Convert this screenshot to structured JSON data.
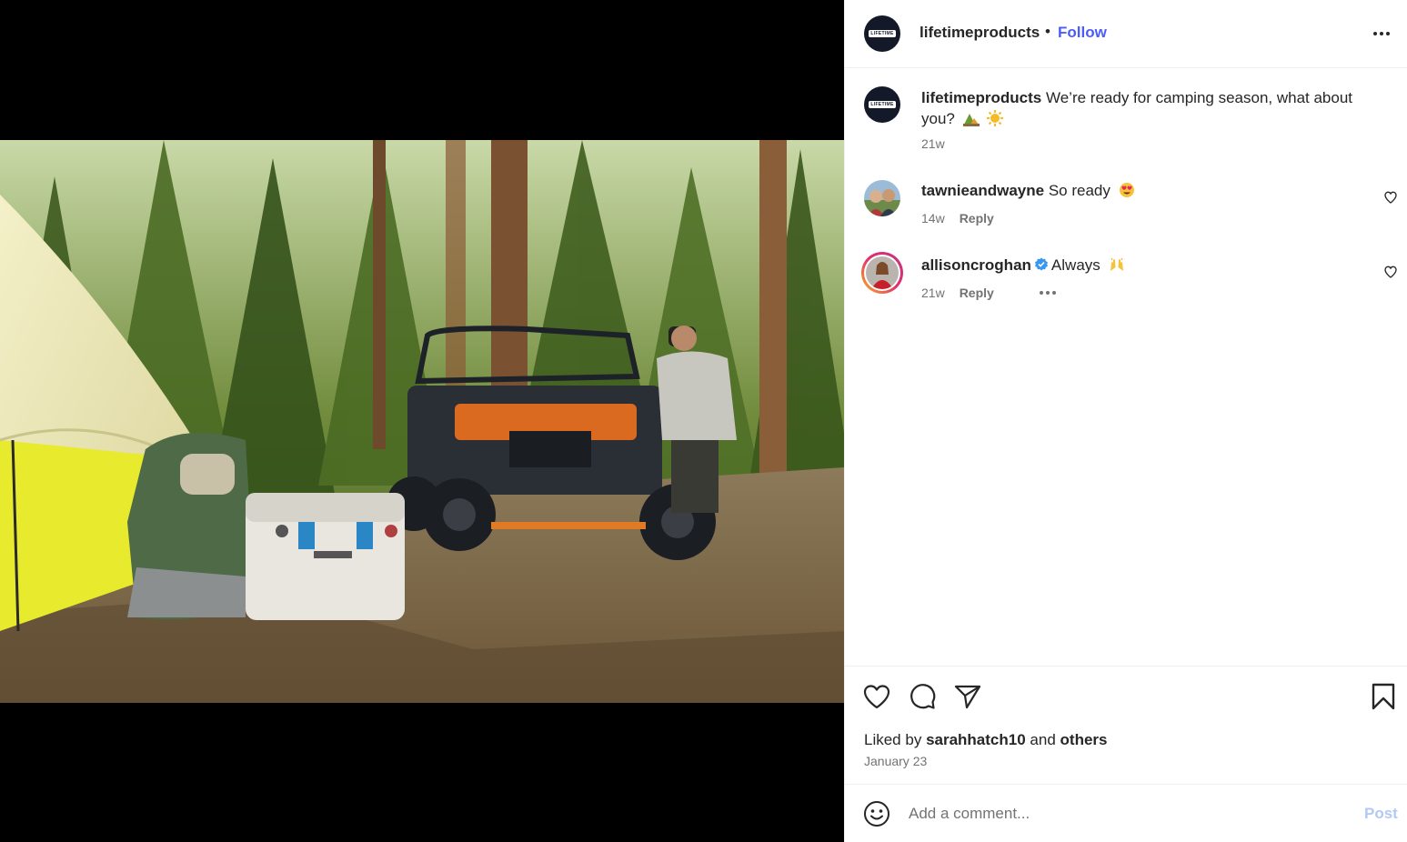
{
  "post": {
    "username": "lifetimeproducts",
    "separator": "•",
    "follow_label": "Follow",
    "avatar_badge": "LIFETIME",
    "caption_text": "We’re ready for camping season, what about you?",
    "caption_time": "21w",
    "liked_prefix": "Liked by",
    "liked_user": "sarahhatch10",
    "liked_and": "and",
    "liked_others": "others",
    "date": "January 23"
  },
  "comments": [
    {
      "username": "tawnieandwayne",
      "text": "So ready",
      "emoji": "heart-eyes-emoji",
      "time": "14w",
      "reply_label": "Reply"
    },
    {
      "username": "allisoncroghan",
      "text": "Always",
      "emoji": "raising-hands-emoji",
      "verified": true,
      "time": "21w",
      "reply_label": "Reply"
    }
  ],
  "comment_bar": {
    "placeholder": "Add a comment...",
    "post_label": "Post"
  },
  "colors": {
    "follow": "#4a5df9",
    "post_disabled": "#b2c9f3",
    "muted": "#737373",
    "verified": "#3897f0"
  },
  "icons": [
    "more-options-icon",
    "like-icon",
    "comment-icon",
    "share-icon",
    "save-icon",
    "emoji-icon",
    "heart-small-icon",
    "verified-icon"
  ]
}
